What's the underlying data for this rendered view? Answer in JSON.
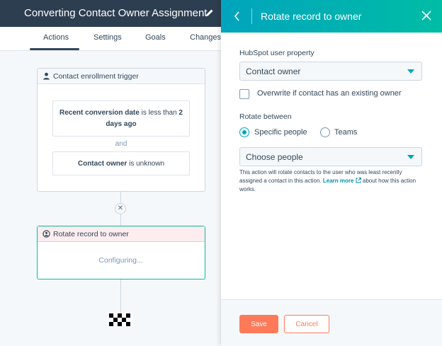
{
  "workflow": {
    "title": "Converting Contact Owner Assignment",
    "tabs": [
      {
        "label": "Actions",
        "active": true
      },
      {
        "label": "Settings"
      },
      {
        "label": "Goals"
      },
      {
        "label": "Changes"
      }
    ],
    "trigger": {
      "header": "Contact enrollment trigger",
      "condition1": {
        "property": "Recent conversion date",
        "operator": " is less than ",
        "value": "2 days ago"
      },
      "joiner": "and",
      "condition2": {
        "property": "Contact owner",
        "operator": " is unknown"
      }
    },
    "action": {
      "header": "Rotate record to owner",
      "status": "Configuring..."
    }
  },
  "panel": {
    "title": "Rotate record to owner",
    "user_property_label": "HubSpot user property",
    "user_property_value": "Contact owner",
    "overwrite_label": "Overwrite if contact has an existing owner",
    "overwrite_checked": false,
    "rotate_between_label": "Rotate between",
    "rotate_options": [
      {
        "label": "Specific people",
        "selected": true
      },
      {
        "label": "Teams",
        "selected": false
      }
    ],
    "people_select_value": "Choose people",
    "help_text_1": "This action will rotate contacts to the user who was least recently assigned a contact in this action. ",
    "help_link": "Learn more",
    "help_text_2": " about how this action works.",
    "save_label": "Save",
    "cancel_label": "Cancel"
  },
  "colors": {
    "header_dark": "#2d3e50",
    "panel_header_start": "#00a4bd",
    "panel_header_end": "#00bda5",
    "primary_orange": "#ff7a59",
    "link": "#0091ae"
  }
}
